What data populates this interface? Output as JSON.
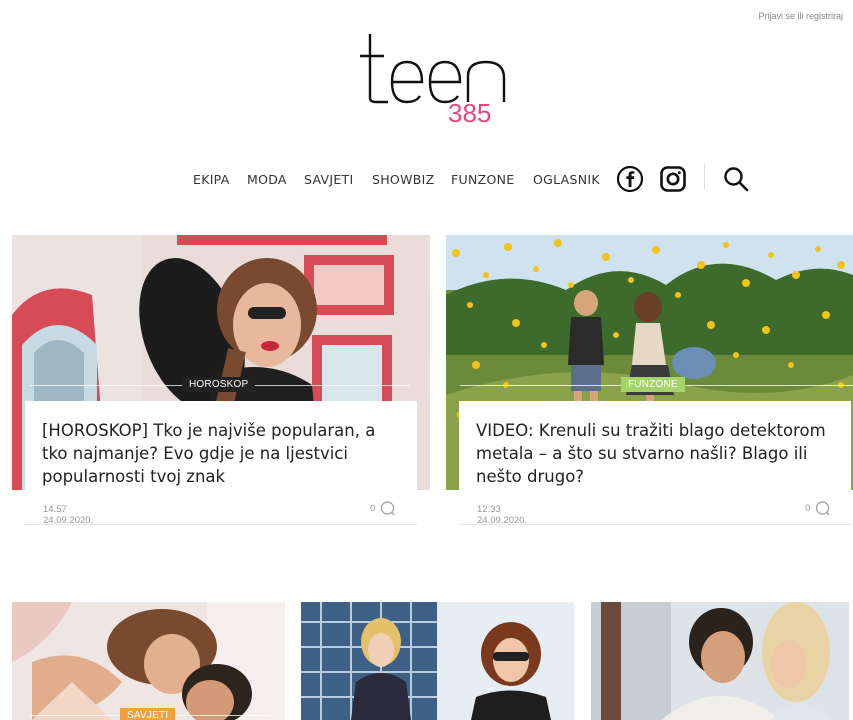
{
  "header": {
    "login_link": "Prijavi se ili registriraj",
    "logo_word": "teen",
    "logo_number": "385"
  },
  "nav": {
    "items": [
      "EKIPA",
      "MODA",
      "SAVJETI",
      "SHOWBIZ",
      "FUNZONE",
      "OGLASNIK"
    ],
    "icons": [
      "facebook-icon",
      "instagram-icon",
      "search-icon"
    ]
  },
  "articles": [
    {
      "tag": "HOROSKOP",
      "tag_color": "#222222",
      "title": "[HOROSKOP] Tko je najviše popularan, a tko najmanje? Evo gdje je na ljestvici popularnosti tvoj znak",
      "date": "14.57 24.09.2020.",
      "comments": "0"
    },
    {
      "tag": "FUNZONE",
      "tag_color": "#a6d36b",
      "title": "VIDEO: Krenuli su tražiti blago detektorom metala – a što su stvarno našli? Blago ili nešto drugo?",
      "date": "12.33 24.09.2020.",
      "comments": "0"
    },
    {
      "tag": "SAVJETI",
      "tag_color": "#f0a040"
    },
    {},
    {}
  ],
  "colors": {
    "accent_pink": "#e8477b",
    "logo_black": "#111111"
  }
}
